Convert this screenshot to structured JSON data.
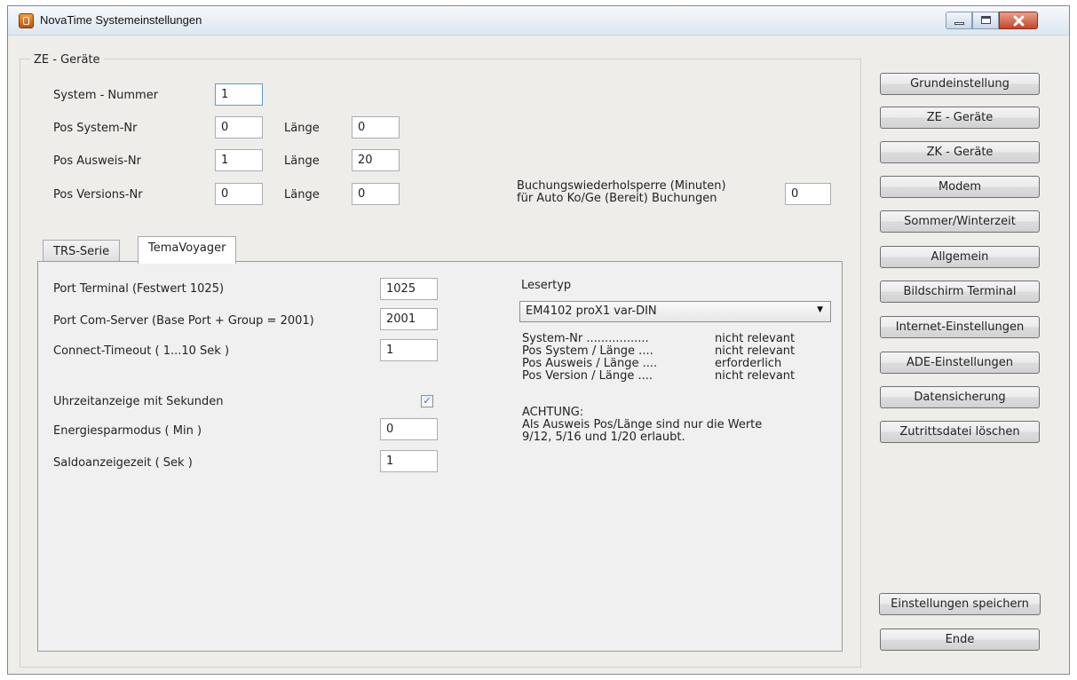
{
  "window": {
    "title": "NovaTime Systemeinstellungen"
  },
  "ze_group": {
    "title": "ZE - Geräte",
    "system_nummer": {
      "label": "System - Nummer",
      "value": "1"
    },
    "pos_system": {
      "label": "Pos System-Nr",
      "value": "0",
      "laenge_label": "Länge",
      "laenge_value": "0"
    },
    "pos_ausweis": {
      "label": "Pos Ausweis-Nr",
      "value": "1",
      "laenge_label": "Länge",
      "laenge_value": "20"
    },
    "pos_version": {
      "label": "Pos Versions-Nr",
      "value": "0",
      "laenge_label": "Länge",
      "laenge_value": "0"
    },
    "buchungssperre": {
      "label_line1": "Buchungswiederholsperre (Minuten)",
      "label_line2": "für Auto Ko/Ge (Bereit) Buchungen",
      "value": "0"
    }
  },
  "tabs": [
    {
      "label": "TRS-Serie",
      "active": false
    },
    {
      "label": "TemaVoyager",
      "active": true
    }
  ],
  "tema": {
    "port_terminal": {
      "label": "Port Terminal (Festwert 1025)",
      "value": "1025"
    },
    "port_com_server": {
      "label": "Port Com-Server (Base Port + Group = 2001)",
      "value": "2001"
    },
    "connect_timeout": {
      "label": "Connect-Timeout ( 1...10 Sek )",
      "value": "1"
    },
    "uhrzeit": {
      "label": "Uhrzeitanzeige mit Sekunden",
      "checked": true,
      "check_glyph": "✓"
    },
    "energiespar": {
      "label": "Energiesparmodus ( Min )",
      "value": "0"
    },
    "saldo": {
      "label": "Saldoanzeigezeit ( Sek )",
      "value": "1"
    },
    "lesertyp": {
      "label": "Lesertyp",
      "selected": "EM4102 proX1 var-DIN",
      "arrow": "▼",
      "info_rows": [
        {
          "left": "System-Nr .................",
          "right": "nicht relevant"
        },
        {
          "left": "Pos System / Länge ....",
          "right": "nicht relevant"
        },
        {
          "left": "Pos Ausweis / Länge ....",
          "right": "erforderlich"
        },
        {
          "left": "Pos Version / Länge ....",
          "right": "nicht relevant"
        }
      ],
      "warning_title": "ACHTUNG:",
      "warning_line1": "Als Ausweis Pos/Länge sind nur die Werte",
      "warning_line2": "9/12, 5/16 und 1/20 erlaubt."
    }
  },
  "sidebar": {
    "buttons": [
      "Grundeinstellung",
      "ZE - Geräte",
      "ZK - Geräte",
      "Modem",
      "Sommer/Winterzeit",
      "Allgemein",
      "Bildschirm Terminal",
      "Internet-Einstellungen",
      "ADE-Einstellungen",
      "Datensicherung",
      "Zutrittsdatei löschen"
    ],
    "save": "Einstellungen speichern",
    "end": "Ende"
  }
}
